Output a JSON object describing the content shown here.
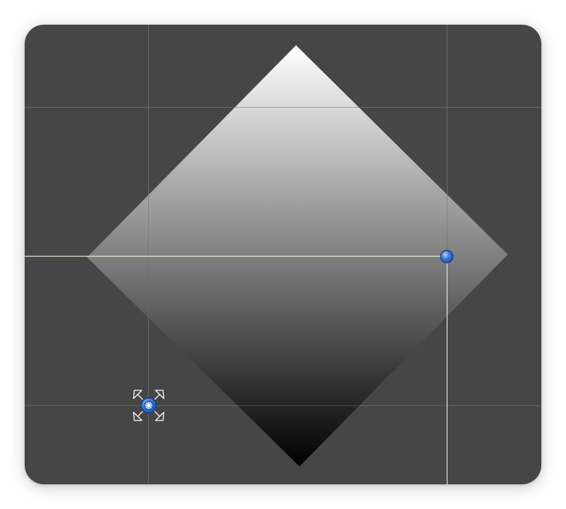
{
  "canvas": {
    "background_color": "#464646",
    "grid_line_color": "#6a6a6a",
    "guide_line_color": "#e8ecd8"
  },
  "gradient_diamond": {
    "fill_top_color": "#ffffff",
    "fill_bottom_color": "#000000",
    "direction": "top-to-bottom"
  },
  "handles": {
    "end_handle": {
      "icon": "blue-dot-handle-icon",
      "fill_color": "#3f7ee0",
      "stroke_color": "#1b3f82"
    },
    "origin_handle": {
      "icon": "crosshair-move-handle-icon",
      "fill_color": "#3f7ee0",
      "stroke_color": "#1b3f82",
      "arrow_color": "#ffffff"
    }
  }
}
